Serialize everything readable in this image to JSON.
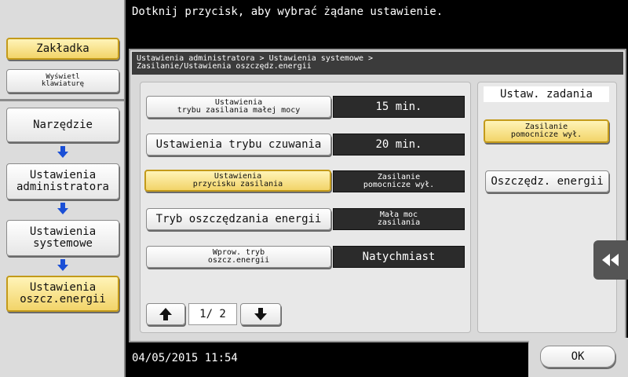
{
  "header": {
    "message": "Dotknij przycisk, aby wybrać żądane ustawienie."
  },
  "sidebar": {
    "tab_label": "Zakładka",
    "keyboard_label_line1": "Wyświetl",
    "keyboard_label_line2": "klawiaturę",
    "crumbs": [
      {
        "label": "Narzędzie"
      },
      {
        "line1": "Ustawienia",
        "line2": "administratora"
      },
      {
        "line1": "Ustawienia",
        "line2": "systemowe"
      },
      {
        "line1": "Ustawienia",
        "line2": "oszcz.energii"
      }
    ]
  },
  "breadcrumb": {
    "line1": "Ustawienia administratora > Ustawienia systemowe >",
    "line2": "Zasilanie/Ustawienia oszczędz.energii"
  },
  "settings": [
    {
      "label_line1": "Ustawienia",
      "label_line2": "trybu zasilania małej mocy",
      "value_line1": "15 min.",
      "value_line2": ""
    },
    {
      "label_line1": "Ustawienia trybu czuwania",
      "label_line2": "",
      "value_line1": "20 min.",
      "value_line2": ""
    },
    {
      "label_line1": "Ustawienia",
      "label_line2": "przycisku zasilania",
      "value_line1": "Zasilanie",
      "value_line2": "pomocnicze wył."
    },
    {
      "label_line1": "Tryb oszczędzania energii",
      "label_line2": "",
      "value_line1": "Mała moc",
      "value_line2": "zasilania"
    },
    {
      "label_line1": "Wprow. tryb",
      "label_line2": "oszcz.energii",
      "value_line1": "Natychmiast",
      "value_line2": ""
    }
  ],
  "pager": {
    "label": "1/ 2"
  },
  "right_panel": {
    "title": "Ustaw. zadania",
    "opt1_line1": "Zasilanie",
    "opt1_line2": "pomocnicze wył.",
    "opt2": "Oszczędz. energii"
  },
  "footer": {
    "datetime": "04/05/2015  11:54",
    "ok_label": "OK"
  },
  "colors": {
    "selected": "#f2d469",
    "selected_border": "#c39a1a",
    "dark_value": "#2b2b2b",
    "arrow_blue": "#1a4fd6"
  }
}
